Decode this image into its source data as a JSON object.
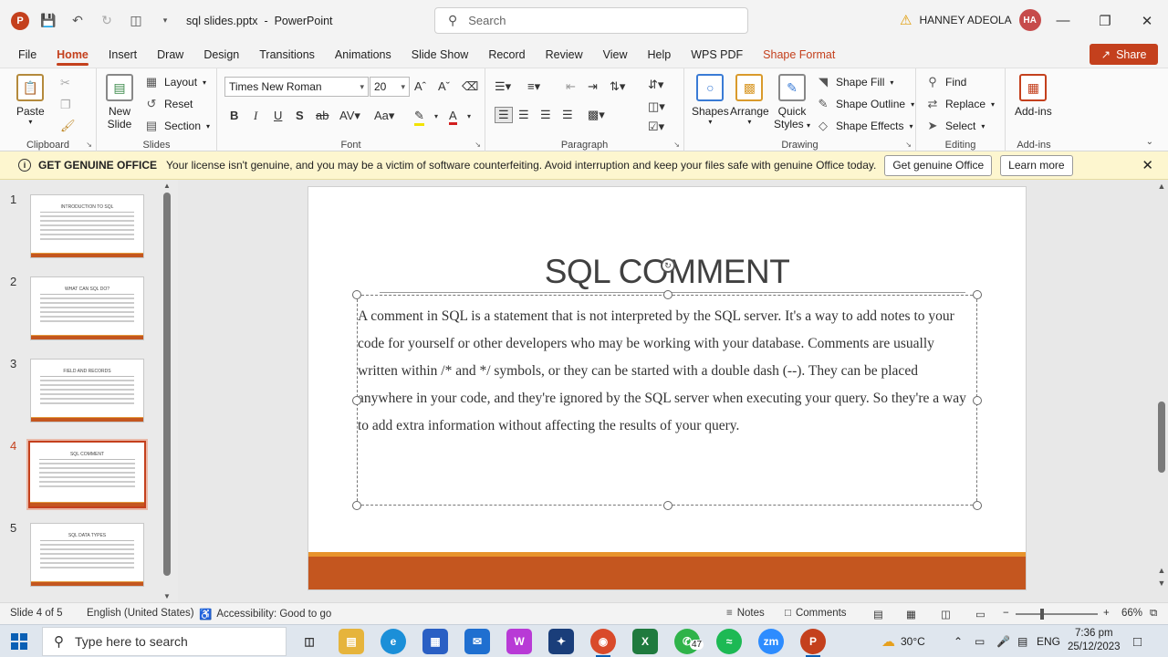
{
  "titlebar": {
    "doc_title": "sql slides.pptx",
    "separator": "-",
    "app_name": "PowerPoint",
    "search_placeholder": "Search",
    "user_name": "HANNEY ADEOLA",
    "user_initials": "HA",
    "logo": "P"
  },
  "menu": {
    "tabs": [
      "File",
      "Home",
      "Insert",
      "Draw",
      "Design",
      "Transitions",
      "Animations",
      "Slide Show",
      "Record",
      "Review",
      "View",
      "Help",
      "WPS PDF",
      "Shape Format"
    ],
    "active_tab": "Home",
    "share_label": "Share"
  },
  "ribbon": {
    "clipboard": {
      "paste": "Paste",
      "label": "Clipboard"
    },
    "slides": {
      "new_slide": "New",
      "new_slide_2": "Slide",
      "layout": "Layout",
      "reset": "Reset",
      "section": "Section",
      "label": "Slides"
    },
    "font": {
      "font_name": "Times New Roman",
      "font_size": "20",
      "label": "Font"
    },
    "paragraph": {
      "label": "Paragraph"
    },
    "drawing": {
      "shapes": "Shapes",
      "arrange": "Arrange",
      "quick_styles": "Quick",
      "quick_styles_2": "Styles",
      "shape_fill": "Shape Fill",
      "shape_outline": "Shape Outline",
      "shape_effects": "Shape Effects",
      "label": "Drawing"
    },
    "editing": {
      "find": "Find",
      "replace": "Replace",
      "select": "Select",
      "label": "Editing"
    },
    "addins": {
      "addins_btn": "Add-ins",
      "label": "Add-ins"
    }
  },
  "notice": {
    "title": "GET GENUINE OFFICE",
    "message": "Your license isn't genuine, and you may be a victim of software counterfeiting. Avoid interruption and keep your files safe with genuine Office today.",
    "button_primary": "Get genuine Office",
    "button_secondary": "Learn more"
  },
  "thumbnails": [
    {
      "num": "1",
      "title": "INTRODUCTION TO SQL"
    },
    {
      "num": "2",
      "title": "WHAT CAN SQL DO?"
    },
    {
      "num": "3",
      "title": "FIELD AND RECORDS"
    },
    {
      "num": "4",
      "title": "SQL COMMENT"
    },
    {
      "num": "5",
      "title": "SQL DATA TYPES"
    }
  ],
  "selected_slide": 4,
  "slide": {
    "title": "SQL COMMENT",
    "body": "A comment in SQL is a statement that is not interpreted by the SQL server. It's a way to add notes to your code for yourself or other developers who may be working with your database. Comments are usually written within /* and */ symbols, or they can be started with a double dash (--). They can be placed anywhere in your code, and they're ignored by the SQL server when executing your query. So they're a way to add extra information without affecting the results of your query."
  },
  "status": {
    "slide_info": "Slide 4 of 5",
    "language": "English (United States)",
    "accessibility": "Accessibility: Good to go",
    "notes": "Notes",
    "comments": "Comments",
    "zoom": "66%"
  },
  "taskbar": {
    "search_placeholder": "Type here to search",
    "temperature": "30°C",
    "language": "ENG",
    "time": "7:36 pm",
    "date": "25/12/2023",
    "whatsapp_badge": "47"
  },
  "colors": {
    "accent": "#c4401d",
    "slide_bar": "#c4561f",
    "slide_stripe": "#e8932c",
    "notice_bg": "#fdf6cf"
  }
}
